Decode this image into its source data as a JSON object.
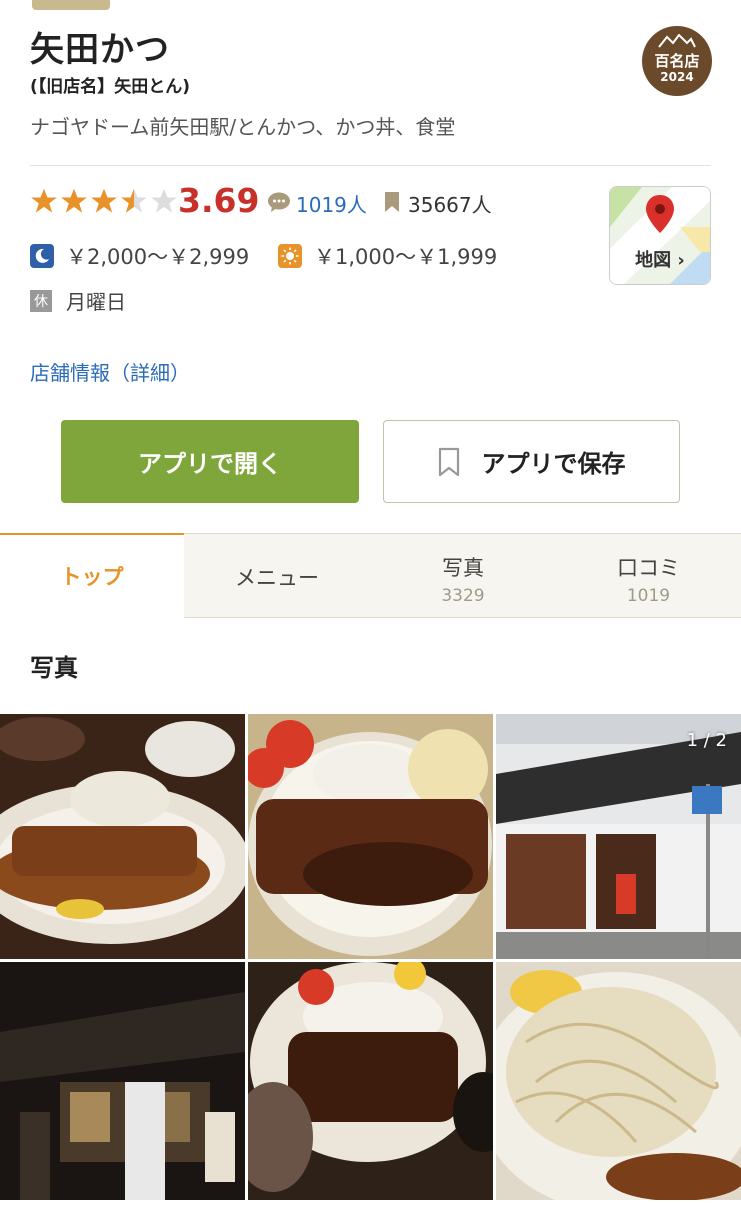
{
  "shop": {
    "name": "矢田かつ",
    "old_name": "(【旧店名】矢田とん)",
    "genre": "ナゴヤドーム前矢田駅/とんかつ、かつ丼、食堂",
    "badge_line1": "百名店",
    "badge_line2": "2024"
  },
  "rating": {
    "score": "3.69",
    "stars": 3.69,
    "reviews": "1019人",
    "saves": "35667人"
  },
  "price": {
    "dinner": "￥2,000～￥2,999",
    "lunch": "￥1,000～￥1,999"
  },
  "holiday": {
    "icon_label": "休",
    "value": "月曜日"
  },
  "map": {
    "label": "地図 ›"
  },
  "detail_link": "店舗情報（詳細）",
  "buttons": {
    "open_app": "アプリで開く",
    "save_app": "アプリで保存"
  },
  "tabs": [
    {
      "label": "トップ",
      "count": ""
    },
    {
      "label": "メニュー",
      "count": ""
    },
    {
      "label": "写真",
      "count": "3329"
    },
    {
      "label": "口コミ",
      "count": "1019"
    }
  ],
  "photos_section": {
    "title": "写真",
    "pager": "1 / 2"
  },
  "icons": {
    "review": "speech-bubble-icon",
    "bookmark": "bookmark-icon",
    "dinner": "moon-icon",
    "lunch": "sun-icon"
  },
  "colors": {
    "accent_orange": "#e8922a",
    "rating_red": "#c8302a",
    "link_blue": "#2b6cb8",
    "green_button": "#7fa63a",
    "badge_brown": "#6b4a2b"
  }
}
